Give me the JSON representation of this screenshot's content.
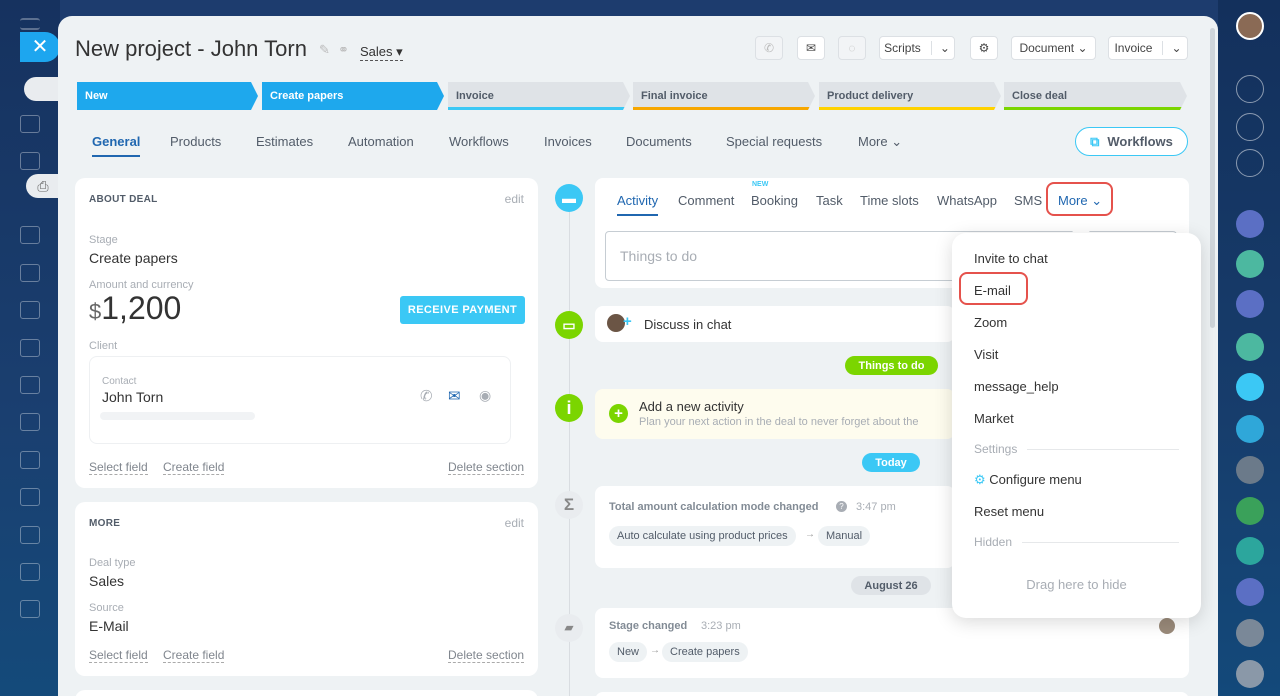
{
  "window": {
    "title": "New project - John Torn",
    "pipeline": "Sales"
  },
  "header_buttons": {
    "scripts": "Scripts",
    "document": "Document",
    "invoice": "Invoice"
  },
  "stages": [
    {
      "label": "New",
      "color": "#1ea8ed",
      "text_color": "#ffffff"
    },
    {
      "label": "Create papers",
      "color": "#1ea8ed",
      "text_color": "#ffffff"
    },
    {
      "label": "Invoice",
      "color": "#dfe3e7",
      "text_color": "#525c69",
      "accent": "#3bc8f5"
    },
    {
      "label": "Final invoice",
      "color": "#dfe3e7",
      "text_color": "#525c69",
      "accent": "#f7a700"
    },
    {
      "label": "Product delivery",
      "color": "#dfe3e7",
      "text_color": "#525c69",
      "accent": "#ffd200"
    },
    {
      "label": "Close deal",
      "color": "#dfe3e7",
      "text_color": "#525c69",
      "accent": "#7bd500"
    }
  ],
  "tabs": [
    "General",
    "Products",
    "Estimates",
    "Automation",
    "Workflows",
    "Invoices",
    "Documents",
    "Special requests",
    "More"
  ],
  "workflows_button": "Workflows",
  "about_deal": {
    "title": "ABOUT DEAL",
    "edit": "edit",
    "stage_label": "Stage",
    "stage_value": "Create papers",
    "amount_label": "Amount and currency",
    "currency": "$",
    "amount": "1,200",
    "receive_payment": "RECEIVE PAYMENT",
    "client_label": "Client",
    "contact_label": "Contact",
    "contact_name": "John Torn",
    "select_field": "Select field",
    "create_field": "Create field",
    "delete_section": "Delete section"
  },
  "more_section": {
    "title": "MORE",
    "edit": "edit",
    "deal_type_label": "Deal type",
    "deal_type_value": "Sales",
    "source_label": "Source",
    "source_value": "E-Mail",
    "select_field": "Select field",
    "create_field": "Create field",
    "delete_section": "Delete section"
  },
  "editor_tabs": {
    "activity": "Activity",
    "comment": "Comment",
    "booking": "Booking",
    "booking_badge": "NEW",
    "task": "Task",
    "time_slots": "Time slots",
    "whatsapp": "WhatsApp",
    "sms": "SMS",
    "more": "More"
  },
  "todo_placeholder": "Things to do",
  "timeline": {
    "discuss": "Discuss in chat",
    "things_to_do_pill": "Things to do",
    "add_activity_title": "Add a new activity",
    "add_activity_sub": "Plan your next action in the deal to never forget about the",
    "today_pill": "Today",
    "calc_title": "Total amount calculation mode changed",
    "calc_time": "3:47 pm",
    "calc_from": "Auto calculate using product prices",
    "calc_to": "Manual",
    "date_pill": "August 26",
    "stage_changed": "Stage changed",
    "stage_time": "3:23 pm",
    "stage_from": "New",
    "stage_to": "Create papers"
  },
  "more_menu": {
    "items": [
      "Invite to chat",
      "E-mail",
      "Zoom",
      "Visit",
      "message_help",
      "Market"
    ],
    "settings_label": "Settings",
    "configure": "Configure menu",
    "reset": "Reset menu",
    "hidden_label": "Hidden",
    "drag_hint": "Drag here to hide"
  },
  "colors": {
    "accent": "#2067b0",
    "primary_button": "#3bc8f5",
    "highlight": "#e5524c",
    "green": "#7bd500"
  }
}
